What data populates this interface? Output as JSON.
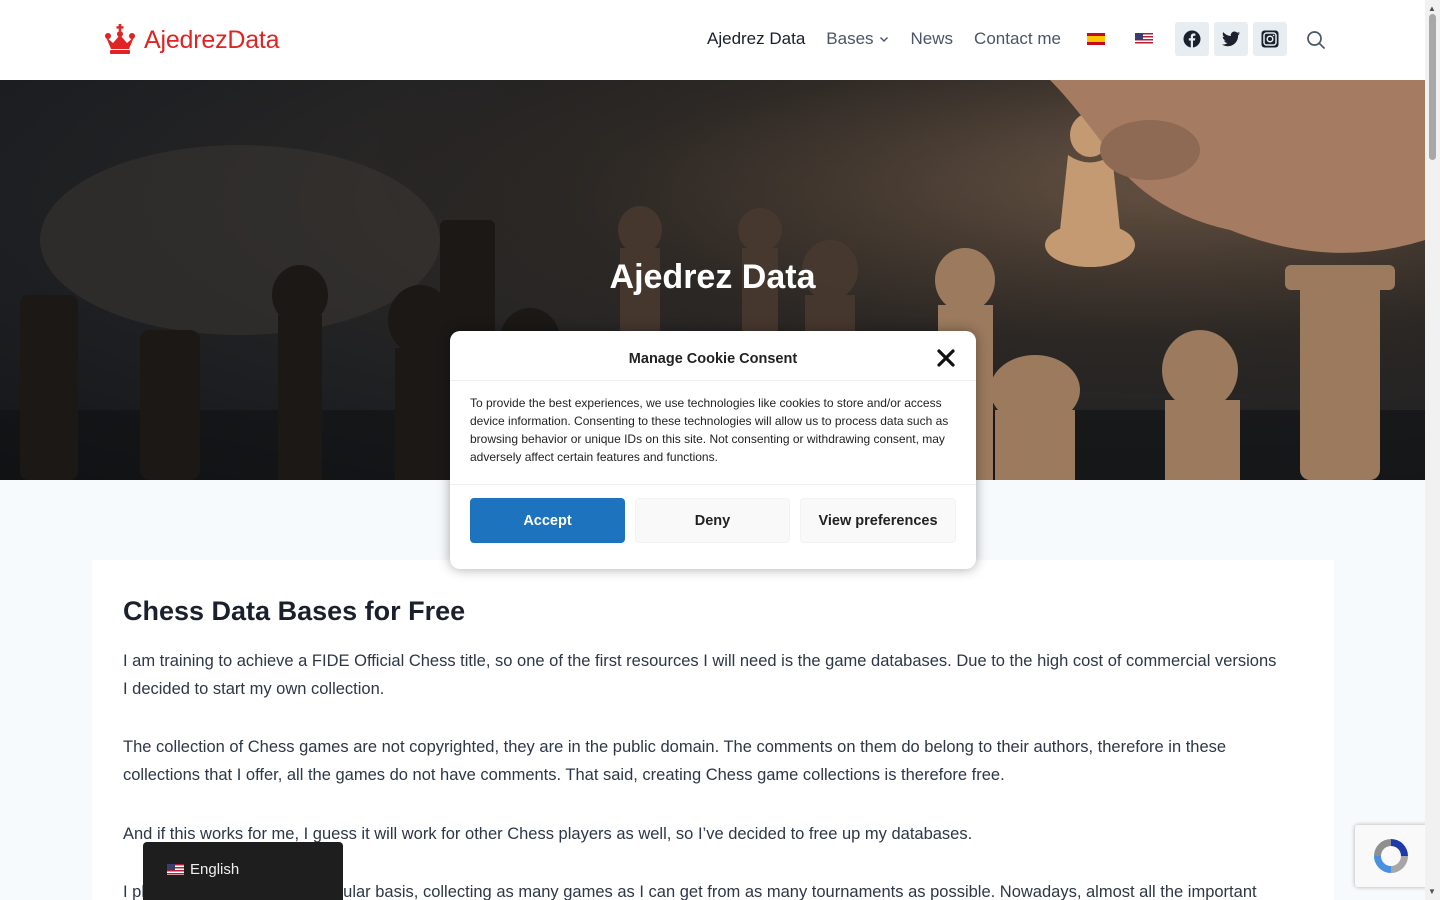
{
  "site": {
    "logo_text": "AjedrezData"
  },
  "nav": {
    "items": [
      {
        "label": "Ajedrez Data"
      },
      {
        "label": "Bases"
      },
      {
        "label": "News"
      },
      {
        "label": "Contact me"
      }
    ],
    "flags": [
      "spanish-flag-icon",
      "us-flag-icon"
    ],
    "social": [
      "facebook-icon",
      "twitter-icon",
      "instagram-icon"
    ],
    "search_icon": "search-icon"
  },
  "hero": {
    "title": "Ajedrez Data"
  },
  "cookie": {
    "title": "Manage Cookie Consent",
    "text": "To provide the best experiences, we use technologies like cookies to store and/or access device information. Consenting to these technologies will allow us to process data such as browsing behavior or unique IDs on this site. Not consenting or withdrawing consent, may adversely affect certain features and functions.",
    "accept_label": "Accept",
    "deny_label": "Deny",
    "prefs_label": "View preferences",
    "accept_color": "#1e73be"
  },
  "article": {
    "title": "Chess Data Bases for Free",
    "paragraphs": [
      "I am training to achieve a FIDE Official Chess title, so one of the first resources I will need is the game databases. Due to the high cost of commercial versions I decided to start my own collection.",
      "The collection of Chess games are not copyrighted, they are in the public domain. The comments on them do belong to their authors, therefore in these collections that I offer, all the games do not have comments. That said, creating Chess game collections is therefore free.",
      "And if this works for me, I guess it will work for other Chess players as well, so I’ve decided to free up my databases.",
      "I plan to update them on a regular basis, collecting as many games as I can get from as many tournaments as possible. Nowadays, almost all the important"
    ]
  },
  "language_switcher": {
    "label": "English"
  },
  "colors": {
    "brand_red": "#e02323",
    "background": "#f7fafc"
  }
}
